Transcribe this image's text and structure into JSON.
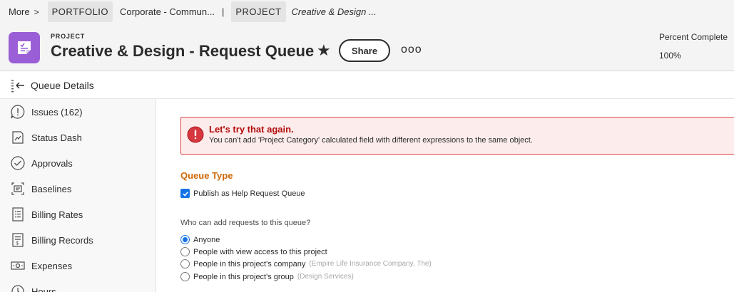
{
  "breadcrumb": {
    "more_label": "More",
    "more_chevron": ">",
    "portfolio_tag": "PORTFOLIO",
    "portfolio_name": "Corporate - Commun...",
    "separator": "|",
    "project_tag": "PROJECT",
    "project_name": "Creative & Design ..."
  },
  "header": {
    "object_type": "PROJECT",
    "title": "Creative & Design - Request Queue",
    "share_label": "Share",
    "more_glyph": "ooo",
    "percent_complete_label": "Percent Complete",
    "percent_complete_value": "100%",
    "icon_color": "#9a5fd6"
  },
  "section": {
    "title": "Queue Details"
  },
  "sidebar": {
    "items": [
      {
        "label": "Issues (162)",
        "icon": "issues-icon"
      },
      {
        "label": "Status Dash",
        "icon": "status-dash-icon"
      },
      {
        "label": "Approvals",
        "icon": "approvals-icon"
      },
      {
        "label": "Baselines",
        "icon": "baselines-icon"
      },
      {
        "label": "Billing Rates",
        "icon": "billing-rates-icon"
      },
      {
        "label": "Billing Records",
        "icon": "billing-records-icon"
      },
      {
        "label": "Expenses",
        "icon": "expenses-icon"
      },
      {
        "label": "Hours",
        "icon": "hours-icon"
      }
    ]
  },
  "error": {
    "title": "Let's try that again.",
    "message": "You can't add 'Project Category' calculated field with different expressions to the same object.",
    "color": "#b30b0b"
  },
  "queue_type": {
    "title": "Queue Type",
    "publish_label": "Publish as Help Request Queue",
    "publish_checked": true
  },
  "who_can_add": {
    "label": "Who can add requests to this queue?",
    "options": [
      {
        "label": "Anyone",
        "hint": "",
        "selected": true
      },
      {
        "label": "People with view access to this project",
        "hint": "",
        "selected": false
      },
      {
        "label": "People in this project's company",
        "hint": "(Empire Life Insurance Company, The)",
        "selected": false
      },
      {
        "label": "People in this project's group",
        "hint": "(Design Services)",
        "selected": false
      }
    ]
  },
  "colors": {
    "accent": "#1473e6",
    "section_heading": "#d0690a",
    "error_border": "#e04848"
  }
}
